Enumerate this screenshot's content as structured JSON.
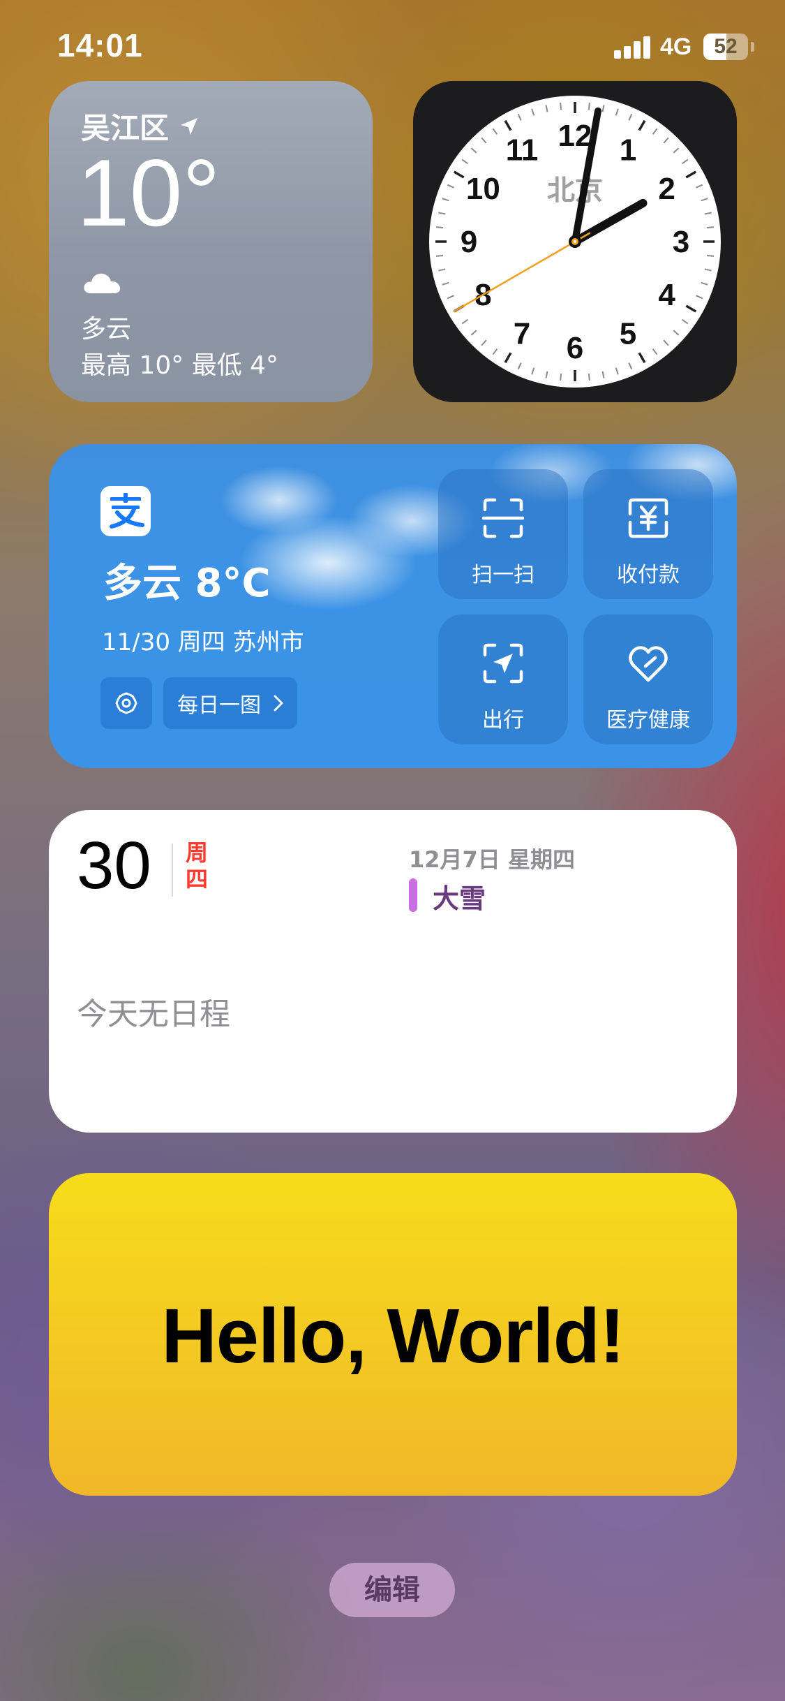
{
  "status_bar": {
    "time": "14:01",
    "network": "4G",
    "battery_level": 52,
    "battery_label": "52"
  },
  "weather": {
    "location": "吴江区",
    "temperature": "10°",
    "condition": "多云",
    "range": "最高 10° 最低 4°",
    "icon": "cloud-icon"
  },
  "clock": {
    "city": "北京",
    "time": "14:01:40",
    "hour": 14,
    "minute": 1,
    "second": 40,
    "numerals": [
      "12",
      "1",
      "2",
      "3",
      "4",
      "5",
      "6",
      "7",
      "8",
      "9",
      "10",
      "11"
    ],
    "second_hand_color": "#f0a020"
  },
  "alipay": {
    "weather": "多云 8°C",
    "date_city": "11/30 周四 苏州市",
    "daily_button": "每日一图",
    "actions": [
      {
        "label": "扫一扫",
        "icon": "scan-icon"
      },
      {
        "label": "收付款",
        "icon": "payment-icon"
      },
      {
        "label": "出行",
        "icon": "travel-icon"
      },
      {
        "label": "医疗健康",
        "icon": "health-icon"
      }
    ],
    "accent_color": "#3a93e6"
  },
  "calendar": {
    "day": "30",
    "weekday": "周四",
    "upcoming_date": "12月7日 星期四",
    "event_title": "大雪",
    "event_color": "#c86ee0",
    "empty_text": "今天无日程"
  },
  "hello": {
    "text": "Hello, World!"
  },
  "edit_button": {
    "label": "编辑"
  }
}
